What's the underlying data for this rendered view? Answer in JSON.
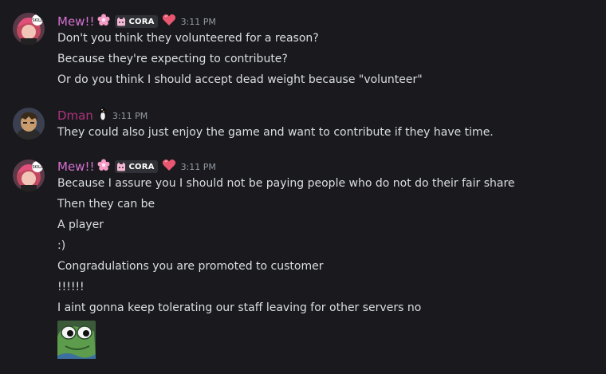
{
  "colors": {
    "background": "#1a1a1e",
    "mew_name": "#d46fd0",
    "dman_name": "#b0327f",
    "text": "#dbdee1",
    "timestamp": "#949ba4"
  },
  "messages": [
    {
      "username": "Mew!!",
      "name_color": "#d46fd0",
      "flower_icon": "flower-icon",
      "tag_icon": "cat-icon",
      "tag": "CORA",
      "heart_icon": "heart-icon",
      "timestamp": "3:11 PM",
      "lines": [
        "Don't you think they volunteered for a reason?",
        "Because they're expecting to contribute?",
        "Or do you think I should accept dead weight because \"volunteer\""
      ]
    },
    {
      "username": "Dman",
      "name_color": "#b0327f",
      "badge_icon": "penguin-icon",
      "timestamp": "3:11 PM",
      "lines": [
        "They could also just enjoy the game and want to contribute if they have time."
      ]
    },
    {
      "username": "Mew!!",
      "name_color": "#d46fd0",
      "flower_icon": "flower-icon",
      "tag_icon": "cat-icon",
      "tag": "CORA",
      "heart_icon": "heart-icon",
      "timestamp": "3:11 PM",
      "lines": [
        "Because I assure you I should not be paying people who do not do their fair share",
        "Then they can be",
        "A player",
        ":)",
        "Congradulations you are promoted to customer",
        "!!!!!!",
        "I aint gonna keep tolerating our staff leaving for other servers no"
      ],
      "emoji": "frog-emoji"
    }
  ]
}
